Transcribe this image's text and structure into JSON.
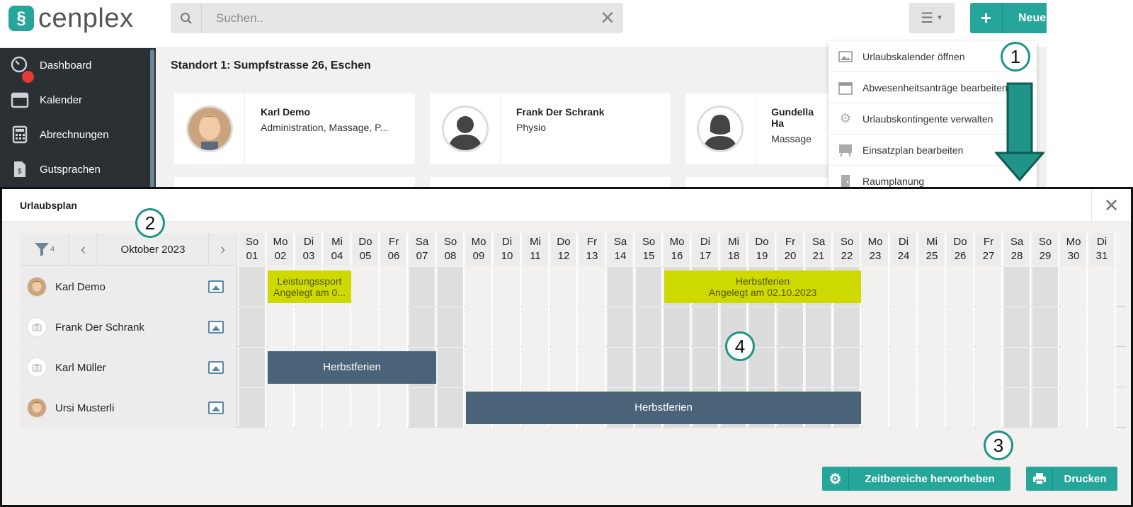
{
  "app": {
    "logo_text": "cenplex",
    "search": {
      "placeholder": "Suchen.."
    },
    "new_button_label": "Neue"
  },
  "sidebar": {
    "items": [
      {
        "label": "Dashboard",
        "icon": "dashboard-icon"
      },
      {
        "label": "Kalender",
        "icon": "calendar-icon"
      },
      {
        "label": "Abrechnungen",
        "icon": "calculator-icon"
      },
      {
        "label": "Gutsprachen",
        "icon": "document-icon"
      }
    ]
  },
  "location": {
    "title": "Standort 1: Sumpfstrasse 26, Eschen"
  },
  "staff": [
    {
      "name": "Karl Demo",
      "role": "Administration, Massage, P..."
    },
    {
      "name": "Frank Der Schrank",
      "role": "Physio"
    },
    {
      "name": "Gundella Ha",
      "role": "Massage"
    }
  ],
  "dropdown": {
    "items": [
      {
        "label": "Urlaubskalender öffnen",
        "icon": "image-icon"
      },
      {
        "label": "Abwesenheitsanträge bearbeiten",
        "icon": "calendar-icon"
      },
      {
        "label": "Urlaubskontingente verwalten",
        "icon": "gear-icon"
      },
      {
        "label": "Einsatzplan bearbeiten",
        "icon": "board-icon"
      },
      {
        "label": "Raumplanung",
        "icon": "door-icon"
      }
    ]
  },
  "callouts": [
    "1",
    "2",
    "3",
    "4"
  ],
  "modal": {
    "title": "Urlaubsplan",
    "filter_count": "4",
    "month": "Oktober 2023",
    "days": [
      {
        "dow": "So",
        "num": "01"
      },
      {
        "dow": "Mo",
        "num": "02"
      },
      {
        "dow": "Di",
        "num": "03"
      },
      {
        "dow": "Mi",
        "num": "04"
      },
      {
        "dow": "Do",
        "num": "05"
      },
      {
        "dow": "Fr",
        "num": "06"
      },
      {
        "dow": "Sa",
        "num": "07"
      },
      {
        "dow": "So",
        "num": "08"
      },
      {
        "dow": "Mo",
        "num": "09"
      },
      {
        "dow": "Di",
        "num": "10"
      },
      {
        "dow": "Mi",
        "num": "11"
      },
      {
        "dow": "Do",
        "num": "12"
      },
      {
        "dow": "Fr",
        "num": "13"
      },
      {
        "dow": "Sa",
        "num": "14"
      },
      {
        "dow": "So",
        "num": "15"
      },
      {
        "dow": "Mo",
        "num": "16"
      },
      {
        "dow": "Di",
        "num": "17"
      },
      {
        "dow": "Mi",
        "num": "18"
      },
      {
        "dow": "Do",
        "num": "19"
      },
      {
        "dow": "Fr",
        "num": "20"
      },
      {
        "dow": "Sa",
        "num": "21"
      },
      {
        "dow": "So",
        "num": "22"
      },
      {
        "dow": "Mo",
        "num": "23"
      },
      {
        "dow": "Di",
        "num": "24"
      },
      {
        "dow": "Mi",
        "num": "25"
      },
      {
        "dow": "Do",
        "num": "26"
      },
      {
        "dow": "Fr",
        "num": "27"
      },
      {
        "dow": "Sa",
        "num": "28"
      },
      {
        "dow": "So",
        "num": "29"
      },
      {
        "dow": "Mo",
        "num": "30"
      },
      {
        "dow": "Di",
        "num": "31"
      }
    ],
    "highlight_range": {
      "from": 16,
      "to": 22
    },
    "employees": [
      {
        "name": "Karl Demo",
        "avatar": "photo"
      },
      {
        "name": "Frank Der Schrank",
        "avatar": "placeholder"
      },
      {
        "name": "Karl Müller",
        "avatar": "placeholder"
      },
      {
        "name": "Ursi Musterli",
        "avatar": "photo"
      }
    ],
    "absences": [
      {
        "row": 0,
        "from": 2,
        "to": 4,
        "style": "yellow",
        "label": "Leistungssport",
        "sub": "Angelegt am 0..."
      },
      {
        "row": 0,
        "from": 16,
        "to": 22,
        "style": "yellow",
        "label": "Herbstferien",
        "sub": "Angelegt am 02.10.2023"
      },
      {
        "row": 2,
        "from": 2,
        "to": 7,
        "style": "slate",
        "label": "Herbstferien",
        "sub": ""
      },
      {
        "row": 3,
        "from": 9,
        "to": 22,
        "style": "slate",
        "label": "Herbstferien",
        "sub": ""
      }
    ],
    "highlight_button_label": "Zeitbereiche hervorheben",
    "print_button_label": "Drucken"
  },
  "colors": {
    "accent": "#26a69a",
    "absence_yellow": "#cdd900",
    "absence_slate": "#4a6378",
    "sidebar": "#2b3035"
  }
}
